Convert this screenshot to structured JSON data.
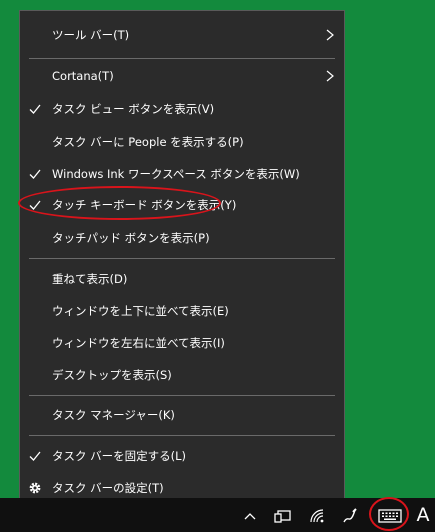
{
  "menu": {
    "items": [
      {
        "label": "ツール バー(T)",
        "checked": false,
        "submenu": true
      },
      {
        "label": "Cortana(T)",
        "checked": false,
        "submenu": true
      },
      {
        "label": "タスク ビュー ボタンを表示(V)",
        "checked": true,
        "submenu": false
      },
      {
        "label": "タスク バーに People を表示する(P)",
        "checked": false,
        "submenu": false
      },
      {
        "label": "Windows Ink ワークスペース ボタンを表示(W)",
        "checked": true,
        "submenu": false
      },
      {
        "label": "タッチ キーボード ボタンを表示(Y)",
        "checked": true,
        "submenu": false
      },
      {
        "label": "タッチパッド ボタンを表示(P)",
        "checked": false,
        "submenu": false
      },
      {
        "label": "重ねて表示(D)",
        "checked": false,
        "submenu": false
      },
      {
        "label": "ウィンドウを上下に並べて表示(E)",
        "checked": false,
        "submenu": false
      },
      {
        "label": "ウィンドウを左右に並べて表示(I)",
        "checked": false,
        "submenu": false
      },
      {
        "label": "デスクトップを表示(S)",
        "checked": false,
        "submenu": false
      },
      {
        "label": "タスク マネージャー(K)",
        "checked": false,
        "submenu": false
      },
      {
        "label": "タスク バーを固定する(L)",
        "checked": true,
        "submenu": false
      },
      {
        "label": "タスク バーの設定(T)",
        "checked": false,
        "submenu": false,
        "icon": "gear-icon"
      }
    ]
  },
  "taskbar": {
    "tray_icons": [
      "chevron-up-icon",
      "device-icon",
      "wifi-icon",
      "pen-icon",
      "keyboard-icon"
    ],
    "ime_indicator": "A"
  },
  "colors": {
    "desktop_background": "#138a3d",
    "menu_background": "#2b2b2b",
    "taskbar_background": "#101010",
    "annotation": "#d9141b"
  }
}
